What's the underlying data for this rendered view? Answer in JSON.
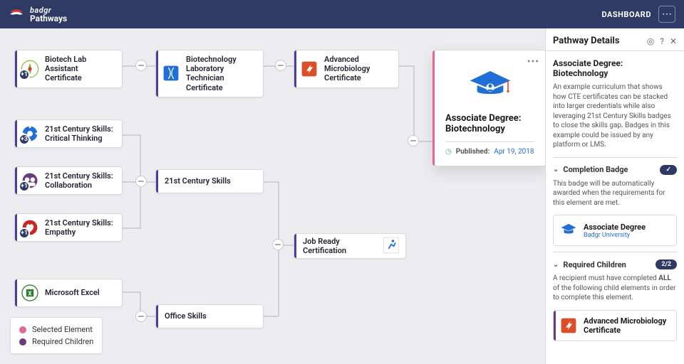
{
  "brand": {
    "line1": "badgr",
    "line2": "Pathways"
  },
  "nav": {
    "dashboard": "DASHBOARD"
  },
  "nodes": {
    "biotech_lab": {
      "label": "Biotech Lab Assistant Certificate",
      "plus": "+1"
    },
    "biotech_tech": {
      "label": "Biotechnology Laboratory Technician Certificate"
    },
    "adv_micro": {
      "label": "Advanced Microbiology Certificate"
    },
    "critical": {
      "label": "21st Century Skills: Critical Thinking",
      "plus": "+3"
    },
    "collab": {
      "label": "21st Century Skills: Collaboration",
      "plus": "+1"
    },
    "empathy": {
      "label": "21st Century Skills: Empathy",
      "plus": "+1"
    },
    "c21": {
      "label": "21st Century Skills"
    },
    "job_ready": {
      "label": "Job Ready Certification"
    },
    "excel": {
      "label": "Microsoft Excel"
    },
    "office": {
      "label": "Office Skills"
    }
  },
  "selected": {
    "title": "Associate Degree: Biotechnology",
    "published_label": "Published:",
    "published_date": "Apr 19, 2018"
  },
  "legend": {
    "selected": "Selected Element",
    "required": "Required Children"
  },
  "panel": {
    "title": "Pathway Details",
    "heading": "Associate Degree: Biotechnology",
    "desc": "An example curriculum that shows how CTE certificates can be stacked into larger credentials while also leveraging 21st Century Skills badges to close the skills gap. Badges in this example could be issued by any platform or LMS.",
    "completion": {
      "title": "Completion Badge",
      "desc": "This badge will be automatically awarded when the requirements for this element are met.",
      "badge_name": "Associate Degree",
      "badge_issuer": "Badgr University"
    },
    "required": {
      "title": "Required Children",
      "count": "2/2",
      "desc_a": "A recipient must have completed ",
      "desc_b": "ALL",
      "desc_c": " of the following child elements in order to complete this element.",
      "child1": "Advanced Microbiology Certificate"
    }
  }
}
